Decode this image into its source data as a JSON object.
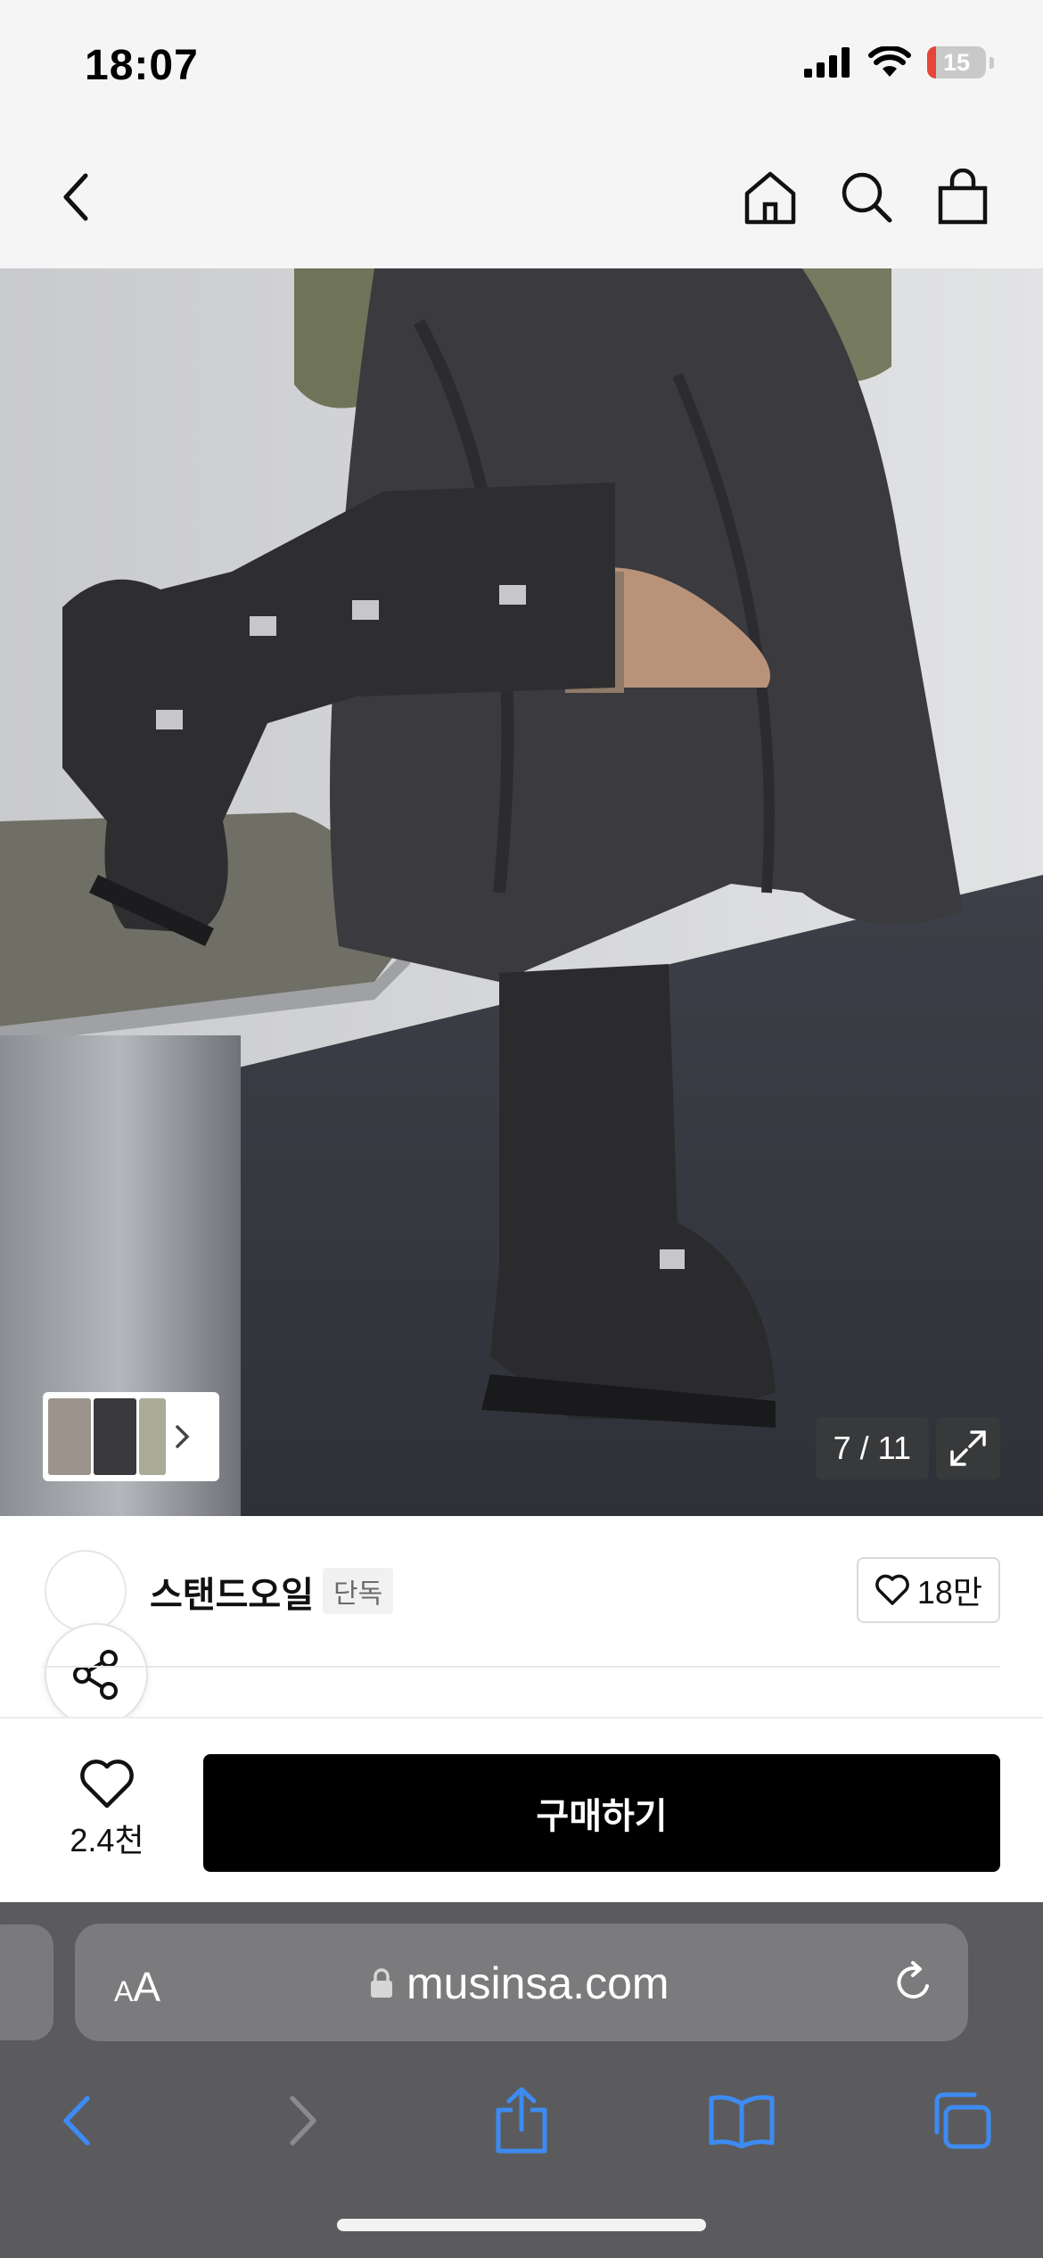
{
  "status": {
    "time": "18:07",
    "battery_level": "15",
    "battery_percent": 15
  },
  "image_gallery": {
    "counter": "7 / 11",
    "current": 7,
    "total": 11
  },
  "brand": {
    "name": "스탠드오일",
    "badge": "단독",
    "like_count": "18만"
  },
  "purchase": {
    "wish_count": "2.4천",
    "buy_label": "구매하기"
  },
  "browser": {
    "text_size_label": "AA",
    "url": "musinsa.com"
  },
  "colors": {
    "accent_blue": "#3d8bf2",
    "buy_button": "#000000",
    "battery_low": "#e6453a",
    "browser_chrome": "#5b5b5d"
  },
  "icons": {
    "header": [
      "back-arrow-icon",
      "home-icon",
      "search-icon",
      "shopping-bag-icon"
    ],
    "browser": [
      "back-icon",
      "forward-icon",
      "share-icon",
      "bookmarks-icon",
      "tabs-icon"
    ]
  }
}
